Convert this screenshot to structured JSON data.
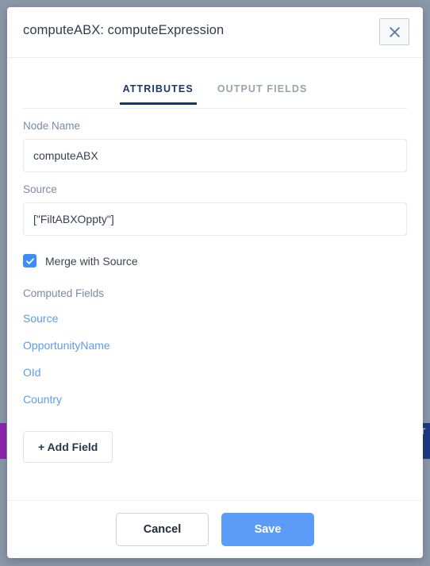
{
  "background": {
    "page_color": "#8b98a9",
    "node_left_color": "#8e24b0",
    "node_right_color": "#1b3a82",
    "node_right_text": "A T"
  },
  "modal": {
    "title": "computeABX: computeExpression",
    "close_icon": "close-icon"
  },
  "tabs": [
    {
      "label": "ATTRIBUTES",
      "active": true
    },
    {
      "label": "OUTPUT FIELDS",
      "active": false
    }
  ],
  "form": {
    "node_name": {
      "label": "Node Name",
      "value": "computeABX",
      "placeholder": "Node Name"
    },
    "source": {
      "label": "Source",
      "value": "[\"FiltABXOppty\"]",
      "placeholder": "Source"
    },
    "merge_with_source": {
      "label": "Merge with Source",
      "checked": true,
      "check_icon": "check-icon",
      "accent_color": "#3b8ef5"
    }
  },
  "computed_fields": {
    "label": "Computed Fields",
    "link_color": "#5c9bf0",
    "items": [
      {
        "label": "Source"
      },
      {
        "label": "OpportunityName"
      },
      {
        "label": "OId"
      },
      {
        "label": "Country"
      }
    ],
    "add_button_label": "+ Add Field"
  },
  "footer": {
    "cancel_label": "Cancel",
    "save_label": "Save",
    "save_color": "#5a9cf8"
  }
}
